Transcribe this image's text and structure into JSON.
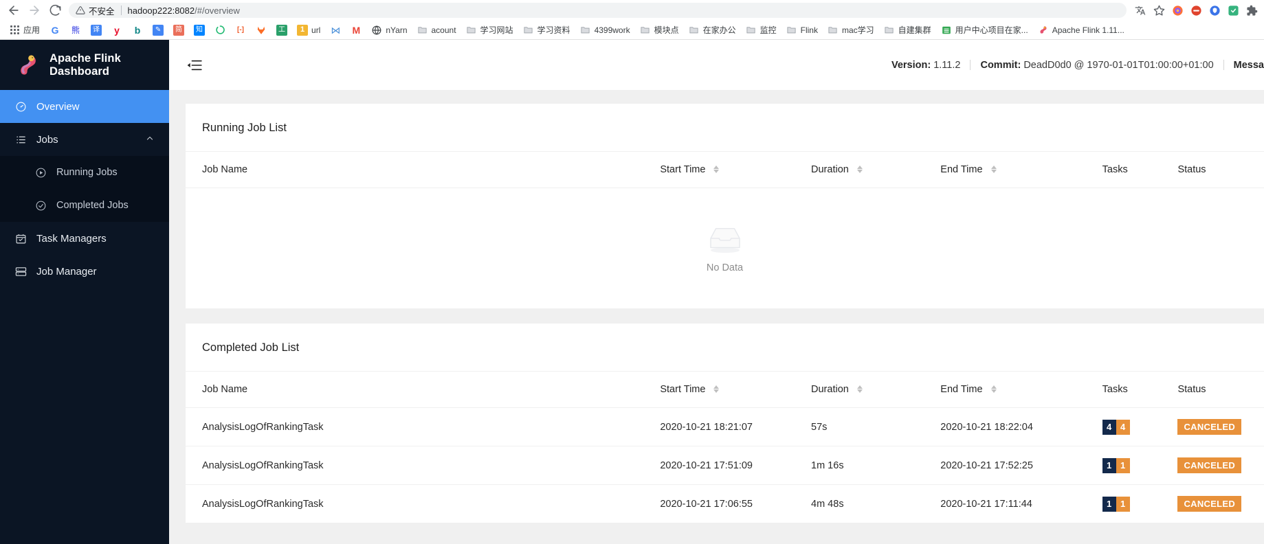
{
  "browser": {
    "back_icon": "arrow-left-icon",
    "forward_icon": "arrow-right-icon",
    "reload_icon": "reload-icon",
    "security_label": "不安全",
    "security_icon": "warning-triangle-icon",
    "url_host": "hadoop222:8082",
    "url_path": "/#/overview",
    "toolbar_icons": [
      "translate-icon",
      "star-icon",
      "firefox-icon",
      "adblock-icon",
      "shield-icon",
      "extension-green-icon",
      "puzzle-icon"
    ],
    "bookmarks": [
      {
        "name": "apps-grid-icon",
        "label": "应用",
        "icon_kind": "apps"
      },
      {
        "name": "google-bookmark",
        "label": "",
        "icon_kind": "letter",
        "glyph": "G",
        "color": "#4285f4",
        "bg": "#ffffff"
      },
      {
        "name": "baidu-bookmark",
        "label": "",
        "icon_kind": "letter",
        "glyph": "熊",
        "color": "#2932e1",
        "bg": "#ffffff"
      },
      {
        "name": "translate-bookmark",
        "label": "",
        "icon_kind": "letter",
        "glyph": "译",
        "color": "#ffffff",
        "bg": "#4285f4"
      },
      {
        "name": "yandex-bookmark",
        "label": "",
        "icon_kind": "letter",
        "glyph": "y",
        "color": "#e8112d",
        "bg": "#ffffff"
      },
      {
        "name": "bing-bookmark",
        "label": "",
        "icon_kind": "letter",
        "glyph": "b",
        "color": "#0c8484",
        "bg": "#ffffff"
      },
      {
        "name": "note-bookmark",
        "label": "",
        "icon_kind": "letter",
        "glyph": "✎",
        "color": "#ffffff",
        "bg": "#4285f4"
      },
      {
        "name": "jianshu-bookmark",
        "label": "",
        "icon_kind": "letter",
        "glyph": "简",
        "color": "#ffffff",
        "bg": "#ea6f5a"
      },
      {
        "name": "zhihu-bookmark",
        "label": "",
        "icon_kind": "letter",
        "glyph": "知",
        "color": "#ffffff",
        "bg": "#0084ff"
      },
      {
        "name": "loading-bookmark",
        "label": "",
        "icon_kind": "circle",
        "color": "#21ba72",
        "bg": "#ffffff"
      },
      {
        "name": "link-bookmark",
        "label": "",
        "icon_kind": "letter",
        "glyph": "[-]",
        "color": "#f05a28",
        "bg": "#ffffff"
      },
      {
        "name": "gitlab-bookmark",
        "label": "",
        "icon_kind": "letter",
        "glyph": "🦊",
        "color": "#fc6d26",
        "bg": "#ffffff"
      },
      {
        "name": "tool-bookmark",
        "label": "",
        "icon_kind": "letter",
        "glyph": "工",
        "color": "#ffffff",
        "bg": "#2aa06a"
      },
      {
        "name": "url-bookmark",
        "label": "url",
        "icon_kind": "letter",
        "glyph": "1",
        "color": "#ffffff",
        "bg": "#f2b632"
      },
      {
        "name": "notion-bookmark",
        "label": "",
        "icon_kind": "letter",
        "glyph": "⋈",
        "color": "#4a90d9",
        "bg": "#ffffff"
      },
      {
        "name": "gmail-bookmark",
        "label": "",
        "icon_kind": "letter",
        "glyph": "M",
        "color": "#ea4335",
        "bg": "#ffffff"
      },
      {
        "name": "nyarn-bookmark",
        "label": "nYarn",
        "icon_kind": "globe",
        "color": "#4a4a4a",
        "bg": "#ffffff"
      },
      {
        "name": "acount-folder",
        "label": "acount",
        "icon_kind": "folder"
      },
      {
        "name": "study-site-folder",
        "label": "学习网站",
        "icon_kind": "folder"
      },
      {
        "name": "study-material-folder",
        "label": "学习资料",
        "icon_kind": "folder"
      },
      {
        "name": "4399work-folder",
        "label": "4399work",
        "icon_kind": "folder"
      },
      {
        "name": "module-folder",
        "label": "模块点",
        "icon_kind": "folder"
      },
      {
        "name": "home-office-folder",
        "label": "在家办公",
        "icon_kind": "folder"
      },
      {
        "name": "monitor-folder",
        "label": "监控",
        "icon_kind": "folder"
      },
      {
        "name": "flink-folder",
        "label": "Flink",
        "icon_kind": "folder"
      },
      {
        "name": "mac-study-folder",
        "label": "mac学习",
        "icon_kind": "folder"
      },
      {
        "name": "self-cluster-folder",
        "label": "自建集群",
        "icon_kind": "folder"
      },
      {
        "name": "user-center-bookmark",
        "label": "用户中心项目在家...",
        "icon_kind": "sheet"
      },
      {
        "name": "apache-flink-bookmark",
        "label": "Apache Flink 1.11...",
        "icon_kind": "flink"
      }
    ]
  },
  "app": {
    "brand": "Apache Flink Dashboard",
    "sidebar": {
      "items": [
        {
          "label": "Overview",
          "icon": "dashboard-icon",
          "active": true
        },
        {
          "label": "Jobs",
          "icon": "list-icon",
          "active": false,
          "expanded": true
        },
        {
          "label": "Running Jobs",
          "icon": "play-circle-icon",
          "sub": true
        },
        {
          "label": "Completed Jobs",
          "icon": "check-circle-icon",
          "sub": true
        },
        {
          "label": "Task Managers",
          "icon": "calendar-check-icon",
          "active": false
        },
        {
          "label": "Job Manager",
          "icon": "server-icon",
          "active": false
        }
      ]
    },
    "topbar": {
      "menu_icon": "menu-fold-icon",
      "version_label": "Version:",
      "version_value": "1.11.2",
      "commit_label": "Commit:",
      "commit_value": "DeadD0d0 @ 1970-01-01T01:00:00+01:00",
      "message_label": "Messa"
    },
    "running_jobs": {
      "title": "Running Job List",
      "columns": [
        "Job Name",
        "Start Time",
        "Duration",
        "End Time",
        "Tasks",
        "Status"
      ],
      "rows": [],
      "empty_text": "No Data",
      "empty_icon": "empty-box-icon"
    },
    "completed_jobs": {
      "title": "Completed Job List",
      "columns": [
        "Job Name",
        "Start Time",
        "Duration",
        "End Time",
        "Tasks",
        "Status"
      ],
      "rows": [
        {
          "job_name": "AnalysisLogOfRankingTask",
          "start_time": "2020-10-21 18:21:07",
          "duration": "57s",
          "end_time": "2020-10-21 18:22:04",
          "tasks_dark": "4",
          "tasks_orange": "4",
          "status": "CANCELED"
        },
        {
          "job_name": "AnalysisLogOfRankingTask",
          "start_time": "2020-10-21 17:51:09",
          "duration": "1m 16s",
          "end_time": "2020-10-21 17:52:25",
          "tasks_dark": "1",
          "tasks_orange": "1",
          "status": "CANCELED"
        },
        {
          "job_name": "AnalysisLogOfRankingTask",
          "start_time": "2020-10-21 17:06:55",
          "duration": "4m 48s",
          "end_time": "2020-10-21 17:11:44",
          "tasks_dark": "1",
          "tasks_orange": "1",
          "status": "CANCELED"
        }
      ]
    }
  },
  "colors": {
    "sidebar_bg": "#0b1524",
    "sidebar_active": "#4391f2",
    "status_canceled": "#e8913a",
    "task_dark": "#13294b"
  }
}
